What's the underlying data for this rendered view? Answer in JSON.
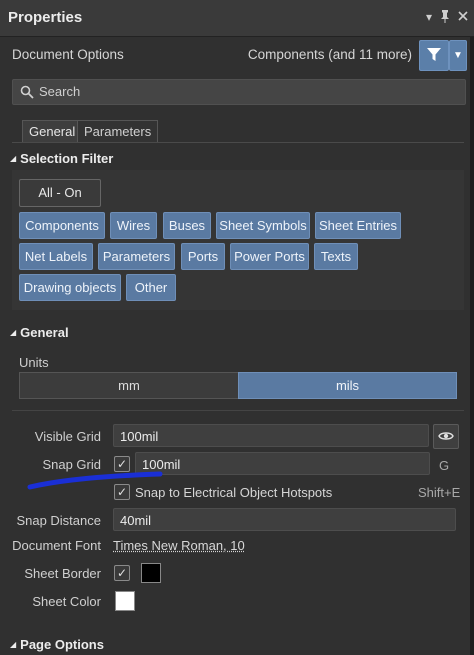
{
  "panel": {
    "title": "Properties",
    "doc_options": "Document Options",
    "components_count": "Components (and 11 more)",
    "search_placeholder": "Search"
  },
  "tabs": [
    {
      "label": "General",
      "active": true
    },
    {
      "label": "Parameters",
      "active": false
    }
  ],
  "selection_filter": {
    "header": "Selection Filter",
    "all_on": "All - On",
    "chips": [
      "Components",
      "Wires",
      "Buses",
      "Sheet Symbols",
      "Sheet Entries",
      "Net Labels",
      "Parameters",
      "Ports",
      "Power Ports",
      "Texts",
      "Drawing objects",
      "Other"
    ]
  },
  "general": {
    "header": "General",
    "units_label": "Units",
    "units": [
      "mm",
      "mils"
    ],
    "selected_unit": "mils",
    "visible_grid_label": "Visible Grid",
    "visible_grid_value": "100mil",
    "snap_grid_label": "Snap Grid",
    "snap_grid_value": "100mil",
    "snap_grid_checked": true,
    "snap_grid_shortcut": "G",
    "snap_hotspots_label": "Snap to Electrical Object Hotspots",
    "snap_hotspots_checked": true,
    "snap_hotspots_shortcut": "Shift+E",
    "snap_distance_label": "Snap Distance",
    "snap_distance_value": "40mil",
    "document_font_label": "Document Font",
    "document_font_value": "Times New Roman, 10",
    "sheet_border_label": "Sheet Border",
    "sheet_border_checked": true,
    "sheet_border_color": "#000000",
    "sheet_color_label": "Sheet Color",
    "sheet_color": "#ffffff"
  },
  "page_options": {
    "header": "Page Options"
  },
  "colors": {
    "accent": "#5a7aa2",
    "annotation_stroke": "#1a2fd6"
  },
  "icons": [
    "dropdown-arrow-icon",
    "pin-icon",
    "close-icon",
    "filter-icon",
    "chevron-down-icon",
    "search-icon",
    "collapse-triangle-icon",
    "eye-icon",
    "check-icon"
  ]
}
